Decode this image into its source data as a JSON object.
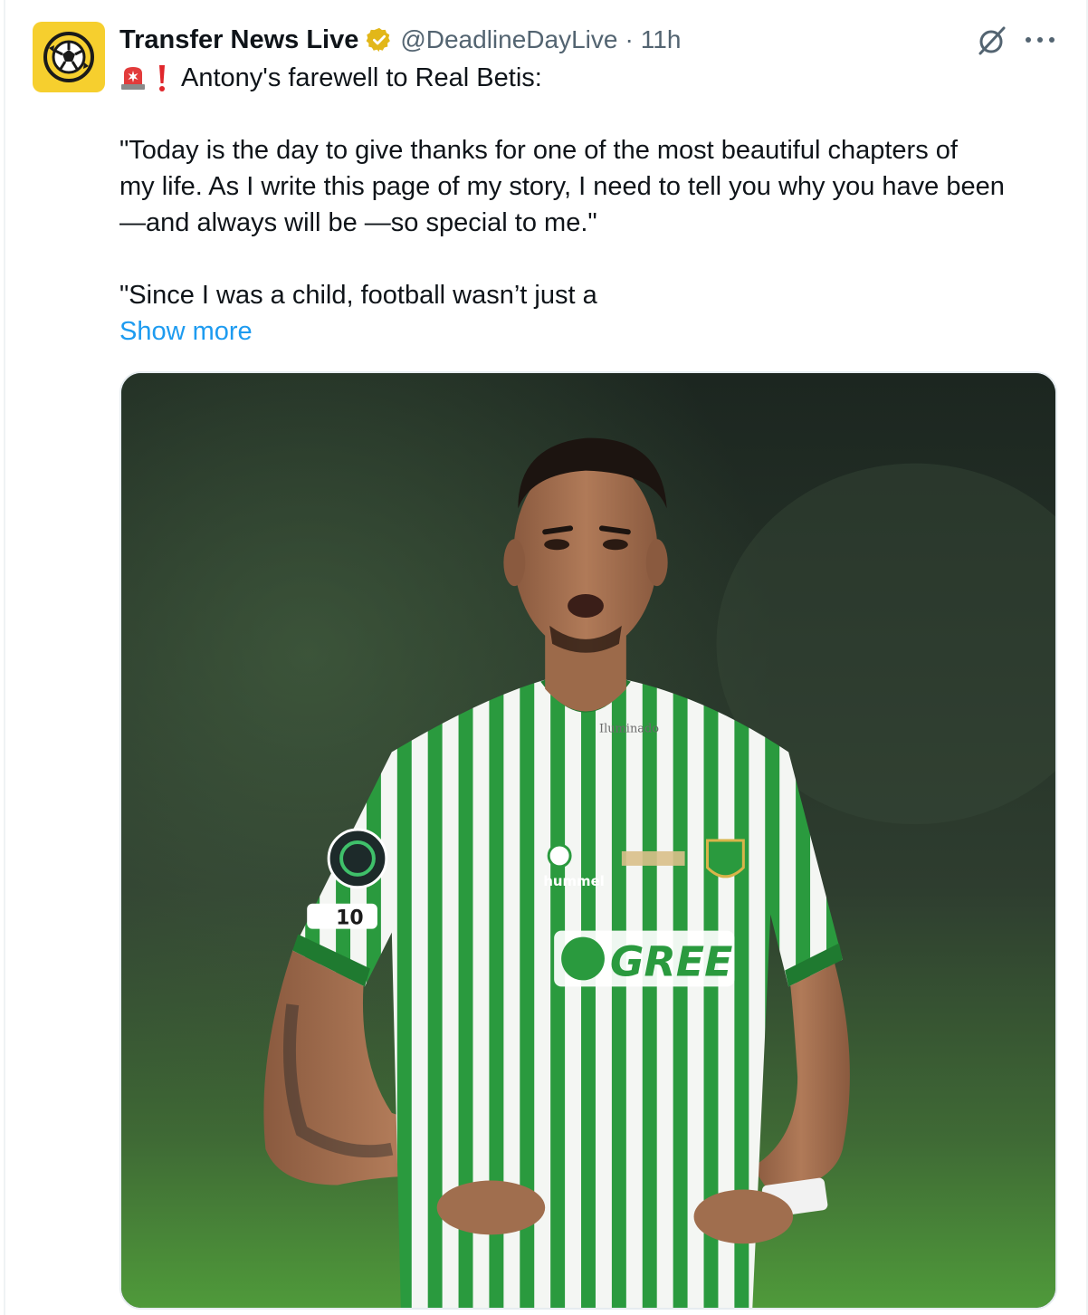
{
  "tweet": {
    "account_name": "Transfer News Live",
    "handle": "@DeadlineDayLive",
    "separator": "·",
    "timestamp": "11h",
    "verified": true,
    "headline": "Antony's farewell to Real Betis:",
    "quote1_line1": "\"Today is the day to give thanks for one of the most beautiful chapters of",
    "quote1_line2": "my life. As I write this page of my story, I need to tell you why you have been",
    "quote1_line3": "—and always will be —so special to me.\"",
    "quote2_line1": "\"Since I was a child, football wasn’t just a",
    "show_more": "Show more"
  },
  "icons": {
    "avatar": "soccer-ball-logo-icon",
    "verified": "verified-gold-badge-icon",
    "siren": "police-siren-emoji-icon",
    "exclamation": "red-exclamation-emoji-icon",
    "grok": "grok-icon",
    "more": "more-options-icon"
  },
  "media": {
    "kit_sponsor": "GREE",
    "kit_brand": "hummel",
    "collar_print": "Iluminado",
    "sleeve_badge": "10"
  },
  "colors": {
    "text": "#0f1419",
    "secondary": "#536471",
    "link": "#1d9bf0",
    "verified_gold": "#e2b719",
    "avatar_bg": "#f6cf2e",
    "betis_green": "#2a9a3e"
  }
}
